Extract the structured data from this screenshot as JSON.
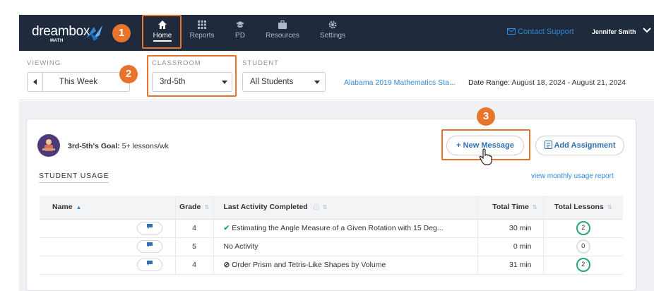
{
  "nav": {
    "logo_word": "dreambox",
    "logo_sub": "MATH",
    "items": [
      {
        "label": "Home",
        "icon": "home-icon",
        "active": true
      },
      {
        "label": "Reports",
        "icon": "grid-icon",
        "active": false
      },
      {
        "label": "PD",
        "icon": "graduation-cap-icon",
        "active": false
      },
      {
        "label": "Resources",
        "icon": "briefcase-icon",
        "active": false
      },
      {
        "label": "Settings",
        "icon": "gear-icon",
        "active": false
      }
    ],
    "contact_support": "Contact Support",
    "user_name": "Jennifer Smith"
  },
  "callouts": [
    "1",
    "2",
    "3"
  ],
  "filters": {
    "viewing_label": "VIEWING",
    "viewing_value": "This Week",
    "classroom_label": "CLASSROOM",
    "classroom_value": "3rd-5th",
    "student_label": "STUDENT",
    "student_value": "All Students",
    "standards": "Alabama 2019 Mathematics Sta...",
    "date_range_label": "Date Range:",
    "date_range_value": "August 18, 2024 - August 21, 2024"
  },
  "goal": {
    "label": "3rd-5th's Goal:",
    "value": "5+ lessons/wk"
  },
  "buttons": {
    "new_message": "+ New Message",
    "add_assignment": "Add Assignment"
  },
  "usage": {
    "title": "STUDENT USAGE",
    "monthly_link": "view monthly usage report",
    "columns": [
      "Name",
      "Grade",
      "Last Activity Completed",
      "Total Time",
      "Total Lessons"
    ],
    "rows": [
      {
        "grade": "4",
        "activity": "Estimating the Angle Measure of a Given Rotation with 15 Deg...",
        "activity_status": "check",
        "time": "30 min",
        "lessons": "2"
      },
      {
        "grade": "5",
        "activity": "No Activity",
        "activity_status": "none",
        "time": "0 min",
        "lessons": "0"
      },
      {
        "grade": "4",
        "activity": "Order Prism and Tetris-Like Shapes by Volume",
        "activity_status": "in-progress",
        "time": "31 min",
        "lessons": "2"
      }
    ]
  },
  "colors": {
    "nav_bg": "#1f2a3c",
    "accent_orange": "#e8732a",
    "link_blue": "#2f89d8",
    "success_green": "#29a56f"
  }
}
